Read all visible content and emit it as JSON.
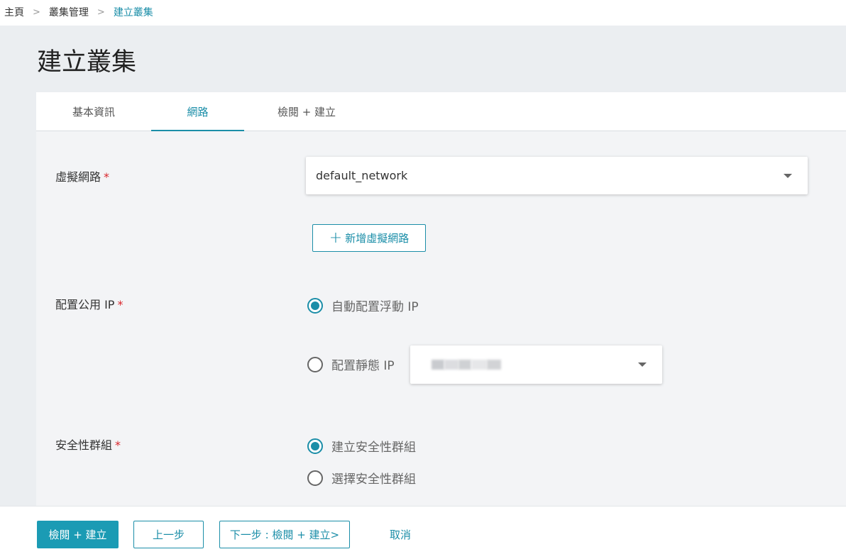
{
  "breadcrumb": {
    "items": [
      "主頁",
      "叢集管理",
      "建立叢集"
    ],
    "separator": ">"
  },
  "page": {
    "title": "建立叢集"
  },
  "tabs": [
    {
      "label": "基本資訊",
      "active": false
    },
    {
      "label": "網路",
      "active": true
    },
    {
      "label": "檢閱 + 建立",
      "active": false
    }
  ],
  "form": {
    "virtual_network": {
      "label": "虛擬網路",
      "required_mark": "*",
      "value": "default_network",
      "add_button_label": "新增虛擬網路",
      "add_icon": "plus-icon"
    },
    "public_ip": {
      "label": "配置公用 IP",
      "required_mark": "*",
      "options": [
        {
          "label": "自動配置浮動 IP",
          "checked": true
        },
        {
          "label": "配置靜態 IP",
          "checked": false
        }
      ]
    },
    "security_group": {
      "label": "安全性群組",
      "required_mark": "*",
      "options": [
        {
          "label": "建立安全性群組",
          "checked": true
        },
        {
          "label": "選擇安全性群組",
          "checked": false
        }
      ]
    }
  },
  "footer": {
    "review_create": "檢閱 + 建立",
    "previous": "上一步",
    "next": "下一步 : 檢閱 + 建立>",
    "cancel": "取消"
  },
  "colors": {
    "accent": "#1b8ea8",
    "primary_button": "#1b9bb4",
    "required": "#d9262c",
    "page_background": "#ebeef1"
  }
}
